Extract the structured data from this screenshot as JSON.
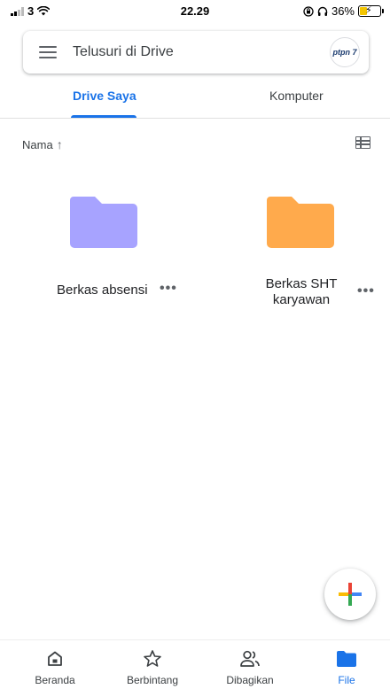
{
  "status_bar": {
    "carrier": "3",
    "time": "22.29",
    "battery_percent": "36%",
    "battery_level": 0.36
  },
  "search": {
    "placeholder": "Telusuri di Drive",
    "avatar_text": "ptpn 7"
  },
  "tabs": [
    {
      "label": "Drive Saya",
      "active": true
    },
    {
      "label": "Komputer",
      "active": false
    }
  ],
  "sort": {
    "label": "Nama",
    "direction_icon": "arrow-up-icon"
  },
  "folders": [
    {
      "name": "Berkas absensi",
      "color": "#a7a3ff"
    },
    {
      "name_line1": "Berkas SHT",
      "name_line2": "karyawan",
      "color": "#ffaa4c"
    }
  ],
  "fab": {
    "icon": "plus-icon"
  },
  "colors": {
    "accent": "#1a73e8",
    "fab_blue": "#4285f4",
    "fab_red": "#ea4335",
    "fab_yellow": "#fbbc04",
    "fab_green": "#34a853"
  },
  "bottom_nav": [
    {
      "label": "Beranda",
      "icon": "home-icon"
    },
    {
      "label": "Berbintang",
      "icon": "star-icon"
    },
    {
      "label": "Dibagikan",
      "icon": "shared-people-icon"
    },
    {
      "label": "File",
      "icon": "folder-icon",
      "active": true
    }
  ]
}
